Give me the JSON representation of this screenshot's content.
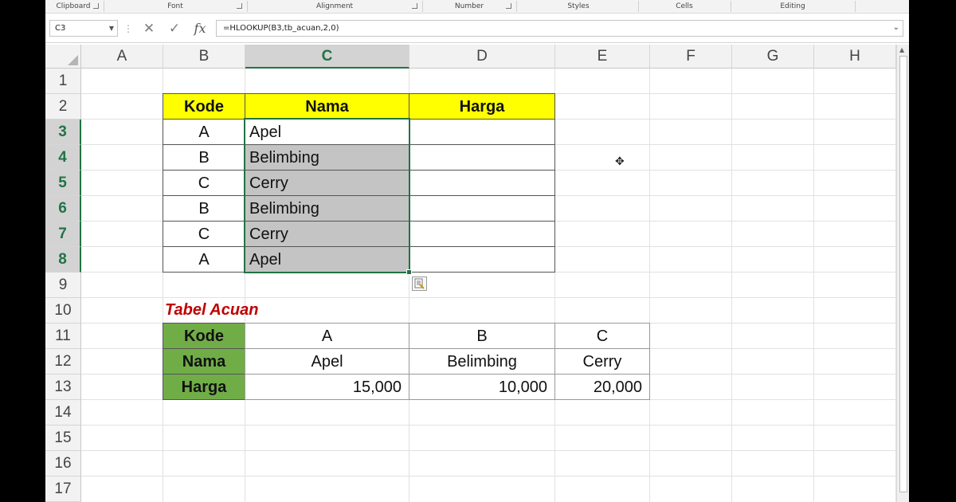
{
  "ribbon": {
    "groups": [
      "Clipboard",
      "Font",
      "Alignment",
      "Number",
      "Styles",
      "Cells",
      "Editing"
    ]
  },
  "formula_bar": {
    "name_box": "C3",
    "formula": "=HLOOKUP(B3,tb_acuan,2,0)"
  },
  "columns": [
    "A",
    "B",
    "C",
    "D",
    "E",
    "F",
    "G",
    "H"
  ],
  "selected_column": "C",
  "rows": [
    "1",
    "2",
    "3",
    "4",
    "5",
    "6",
    "7",
    "8",
    "9",
    "10",
    "11",
    "12",
    "13",
    "14",
    "15",
    "16",
    "17"
  ],
  "selected_rows": [
    "3",
    "4",
    "5",
    "6",
    "7",
    "8"
  ],
  "table1": {
    "headers": [
      "Kode",
      "Nama",
      "Harga"
    ],
    "rows": [
      {
        "kode": "A",
        "nama": "Apel",
        "harga": ""
      },
      {
        "kode": "B",
        "nama": "Belimbing",
        "harga": ""
      },
      {
        "kode": "C",
        "nama": "Cerry",
        "harga": ""
      },
      {
        "kode": "B",
        "nama": "Belimbing",
        "harga": ""
      },
      {
        "kode": "C",
        "nama": "Cerry",
        "harga": ""
      },
      {
        "kode": "A",
        "nama": "Apel",
        "harga": ""
      }
    ],
    "header_color": "#ffff00",
    "fill_color": "#c4c4c4"
  },
  "table2": {
    "title": "Tabel Acuan",
    "title_color": "#c00000",
    "header_color": "#70ad47",
    "row_labels": [
      "Kode",
      "Nama",
      "Harga"
    ],
    "kode": [
      "A",
      "B",
      "C"
    ],
    "nama": [
      "Apel",
      "Belimbing",
      "Cerry"
    ],
    "harga": [
      "15,000",
      "10,000",
      "20,000"
    ]
  },
  "accent_color": "#217346"
}
